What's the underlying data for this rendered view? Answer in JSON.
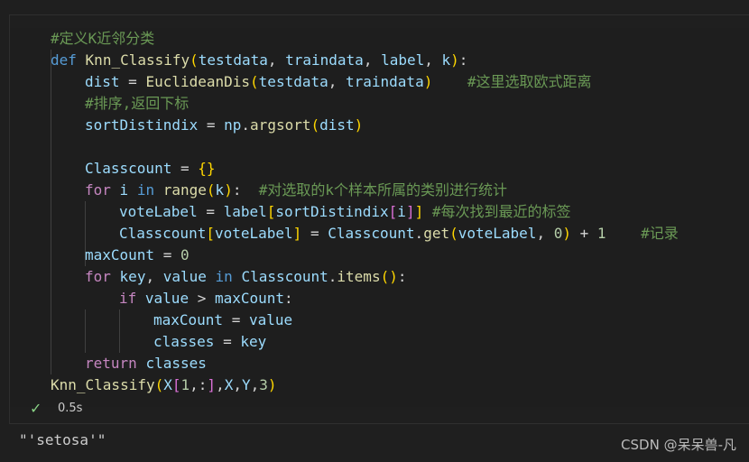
{
  "code": {
    "lines": [
      "#定义K近邻分类",
      "def Knn_Classify(testdata, traindata, label, k):",
      "    dist = EuclideanDis(testdata, traindata)    #这里选取欧式距离",
      "    #排序,返回下标",
      "    sortDistindix = np.argsort(dist)",
      "",
      "    Classcount = {}",
      "    for i in range(k):  #对选取的k个样本所属的类别进行统计",
      "        voteLabel = label[sortDistindix[i]] #每次找到最近的标签",
      "        Classcount[voteLabel] = Classcount.get(voteLabel, 0) + 1    #记录",
      "    maxCount = 0",
      "    for key, value in Classcount.items():",
      "        if value > maxCount:",
      "            maxCount = value",
      "            classes = key",
      "    return classes",
      "Knn_Classify(X[1,:],X,Y,3)"
    ]
  },
  "status": {
    "icon": "check-icon",
    "time": "0.5s"
  },
  "output": "\"'setosa'\"",
  "watermark": "CSDN @呆呆兽-凡"
}
